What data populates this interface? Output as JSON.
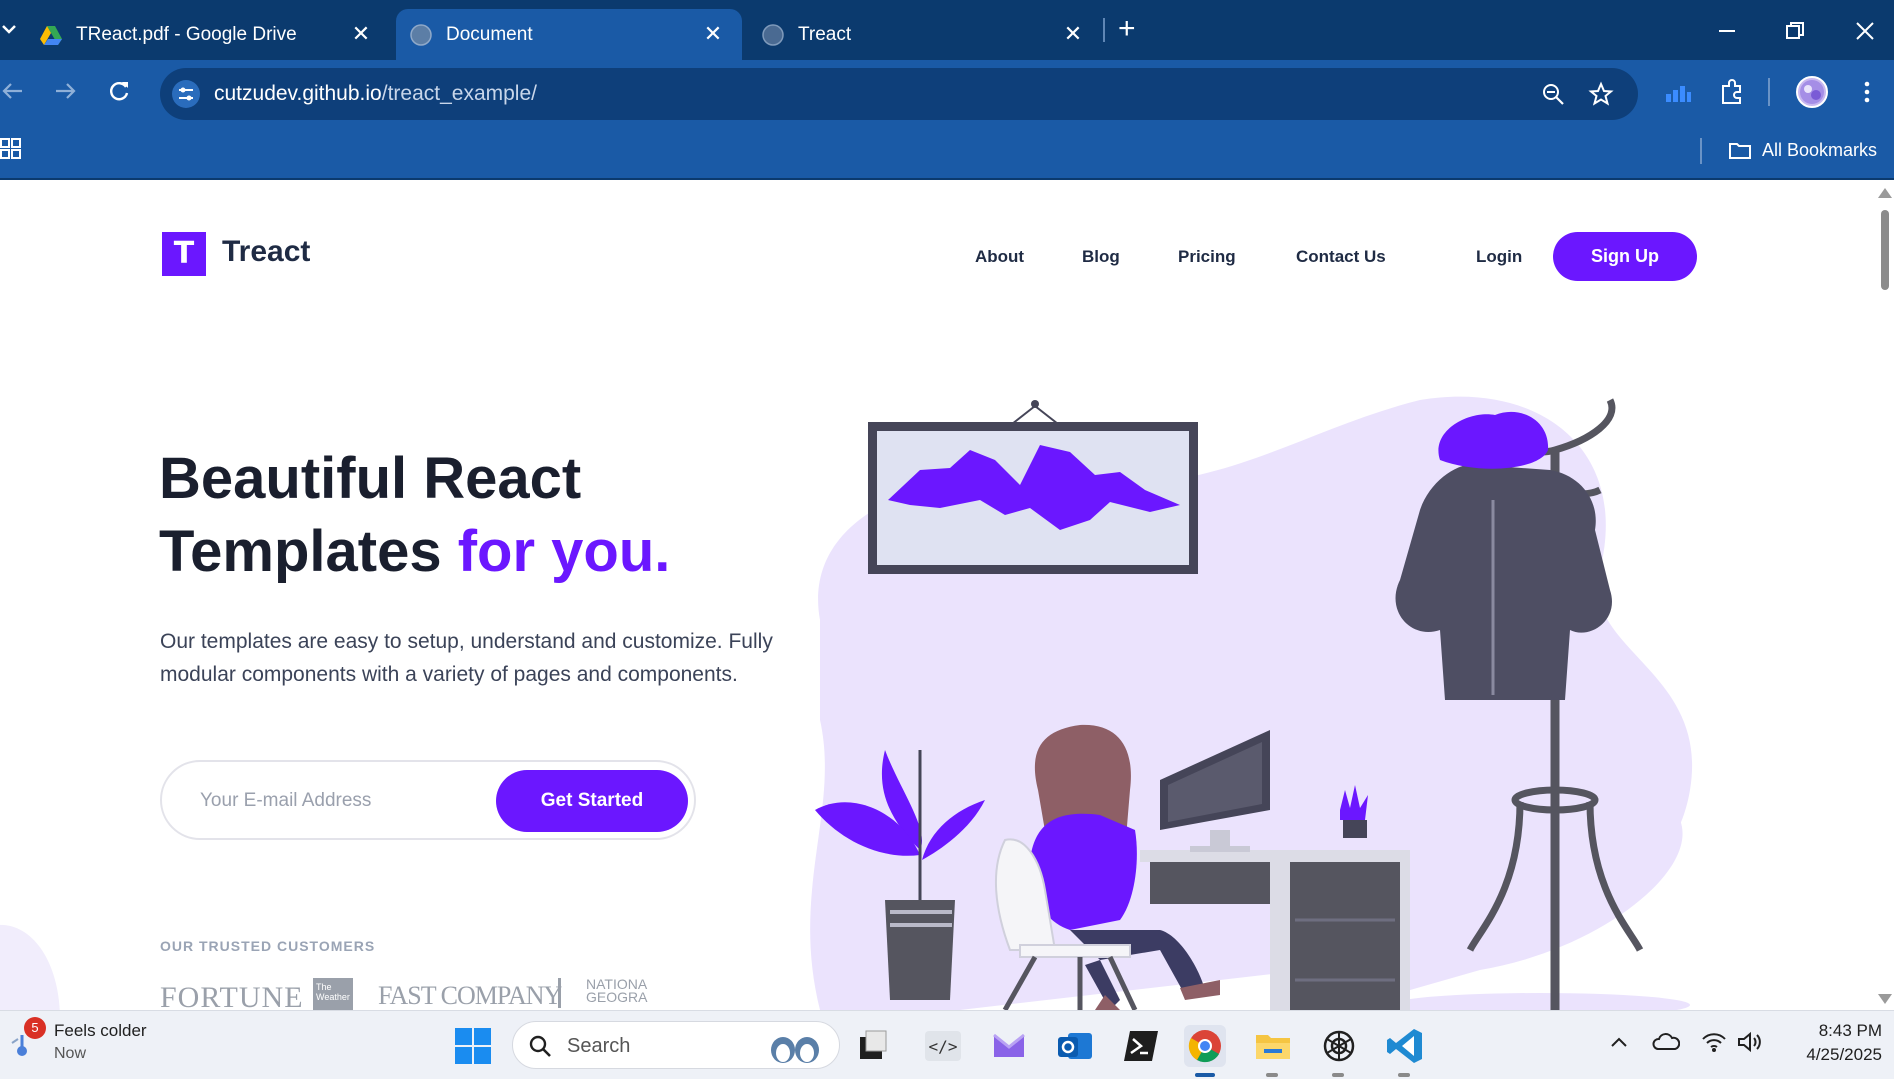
{
  "browser": {
    "tabs": [
      {
        "title": "TReact.pdf - Google Drive",
        "active": false
      },
      {
        "title": "Document",
        "active": true
      },
      {
        "title": "Treact",
        "active": false
      }
    ],
    "url_host": "cutzudev.github.io",
    "url_path": "/treact_example/",
    "bookmarks_label": "All Bookmarks"
  },
  "site": {
    "logo_letter": "T",
    "brand": "Treact",
    "nav": [
      "About",
      "Blog",
      "Pricing",
      "Contact Us"
    ],
    "login": "Login",
    "signup": "Sign Up",
    "headline_line1": "Beautiful React",
    "headline_line2_plain": "Templates ",
    "headline_line2_accent": "for you.",
    "description": "Our templates are easy to setup, understand and customize. Fully modular components with a variety of pages and components.",
    "email_placeholder": "Your E-mail Address",
    "cta": "Get Started",
    "trusted_label": "OUR TRUSTED CUSTOMERS",
    "customers": [
      "FORTUNE",
      "The Weather",
      "FAST COMPANY",
      "NATIONAL GEOGRAPHIC"
    ]
  },
  "taskbar": {
    "weather_badge": "5",
    "weather_title": "Feels colder",
    "weather_sub": "Now",
    "search_label": "Search",
    "time": "8:43 PM",
    "date": "4/25/2025"
  },
  "colors": {
    "accent": "#6b17ff",
    "tabstrip": "#0b3a6e",
    "toolbar": "#1a5aa6"
  }
}
